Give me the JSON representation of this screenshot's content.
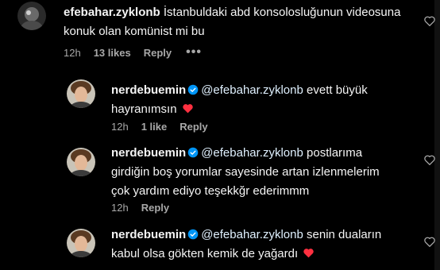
{
  "comments": [
    {
      "username": "efebahar.zyklonb",
      "text": "İstanbuldaki abd konsolosluğunun videosuna konuk olan komünist mi bu",
      "time": "12h",
      "likes": "13 likes",
      "reply": "Reply",
      "more": "•••"
    },
    {
      "username": "nerdebuemin",
      "mention": "@efebahar.zyklonb",
      "line1_rest": "evett büyük",
      "line2": "hayranımsın",
      "time": "12h",
      "likes": "1 like",
      "reply": "Reply"
    },
    {
      "username": "nerdebuemin",
      "mention": "@efebahar.zyklonb",
      "line1_rest": "postlarıma",
      "line2": "girdiğin boş yorumlar sayesinde artan izlenmelerim",
      "line3": "çok yardım ediyo teşekkğr ederimmm",
      "time": "12h",
      "reply": "Reply"
    },
    {
      "username": "nerdebuemin",
      "mention": "@efebahar.zyklonb",
      "line1_rest": "senin duaların",
      "line2": "kabul olsa gökten kemik de yağardı"
    }
  ],
  "colors": {
    "background": "#000000",
    "text": "#f5f5f5",
    "muted": "#a8a8a8",
    "verified": "#0095f6",
    "heart": "#ff3040"
  }
}
